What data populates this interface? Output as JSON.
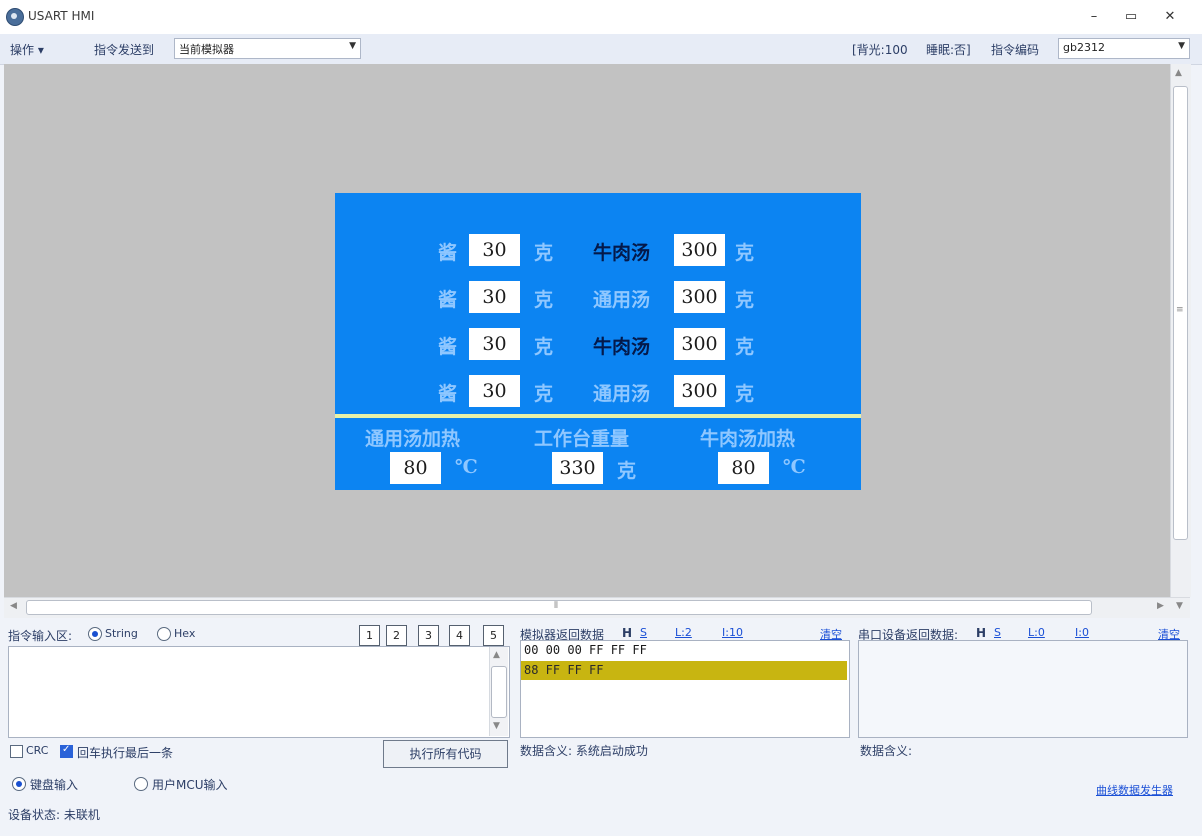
{
  "window": {
    "title": "USART HMI",
    "min": "–",
    "max": "▭",
    "close": "✕"
  },
  "toolbar": {
    "ops_label": "操作",
    "send_to_label": "指令发送到",
    "send_to_value": "当前模拟器",
    "backlight": "[背光:100",
    "sleep": "睡眠:否]",
    "encoding_label": "指令编码",
    "encoding_value": "gb2312"
  },
  "hmi": {
    "rows": [
      {
        "left_label": "酱",
        "left_value": "30",
        "left_unit": "克",
        "right_label": "牛肉汤",
        "right_dark": true,
        "right_value": "300",
        "right_unit": "克"
      },
      {
        "left_label": "酱",
        "left_value": "30",
        "left_unit": "克",
        "right_label": "通用汤",
        "right_dark": false,
        "right_value": "300",
        "right_unit": "克"
      },
      {
        "left_label": "酱",
        "left_value": "30",
        "left_unit": "克",
        "right_label": "牛肉汤",
        "right_dark": true,
        "right_value": "300",
        "right_unit": "克"
      },
      {
        "left_label": "酱",
        "left_value": "30",
        "left_unit": "克",
        "right_label": "通用汤",
        "right_dark": false,
        "right_value": "300",
        "right_unit": "克"
      }
    ],
    "bottom": [
      {
        "label": "通用汤加热",
        "value": "80",
        "unit": "℃"
      },
      {
        "label": "工作台重量",
        "value": "330",
        "unit": "克"
      },
      {
        "label": "牛肉汤加热",
        "value": "80",
        "unit": "℃"
      }
    ]
  },
  "cmd_input": {
    "label": "指令输入区:",
    "mode_string": "String",
    "mode_hex": "Hex",
    "tabs": [
      "1",
      "2",
      "3",
      "4",
      "5"
    ],
    "crc_label": "CRC",
    "enter_exec_label": "回车执行最后一条",
    "exec_all_button": "执行所有代码",
    "keyboard_input": "键盘输入",
    "user_mcu_input": "用户MCU输入",
    "device_status": "设备状态: 未联机"
  },
  "sim_return": {
    "label": "模拟器返回数据",
    "h": "H",
    "s": "S",
    "l": "L:2",
    "i": "I:10",
    "clear": "清空",
    "lines": [
      "00 00 00 FF FF FF",
      "88 FF FF FF"
    ],
    "meaning": "数据含义: 系统启动成功"
  },
  "serial_return": {
    "label": "串口设备返回数据:",
    "h": "H",
    "s": "S",
    "l": "L:0",
    "i": "I:0",
    "clear": "清空",
    "meaning": "数据含义:",
    "generator_link": "曲线数据发生器"
  }
}
